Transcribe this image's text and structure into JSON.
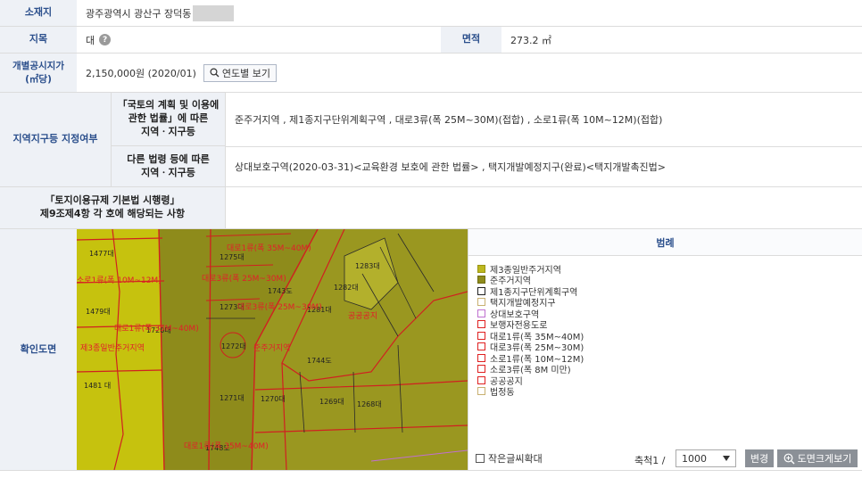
{
  "location": {
    "label": "소재지",
    "value": "광주광역시 광산구 장덕동"
  },
  "land_category": {
    "label": "지목",
    "value": "대",
    "help": "?",
    "area_label": "면적",
    "area_value": "273.2 ㎡"
  },
  "price": {
    "label": "개별공시지가\n(㎡당)",
    "value": "2,150,000원 (2020/01)",
    "button": "연도별 보기"
  },
  "zoning": {
    "label": "지역지구등 지정여부",
    "national_label": "「국토의 계획 및 이용에\n관한 법률」에 따른\n지역ㆍ지구등",
    "national_value": "준주거지역 , 제1종지구단위계획구역 , 대로3류(폭 25M~30M)(접합) , 소로1류(폭 10M~12M)(접합)",
    "other_label": "다른 법령 등에 따른\n지역ㆍ지구등",
    "other_value": "상대보호구역(2020-03-31)<교육환경 보호에 관한 법률> , 택지개발예정지구(완료)<택지개발촉진법>"
  },
  "enforcement": {
    "label": "「토지이용규제 기본법 시행령」\n제9조제4항 각 호에 해당되는 사항",
    "value": ""
  },
  "map_section": {
    "label": "확인도면",
    "parcels": [
      "1477대",
      "1275대",
      "1283대",
      "1282대",
      "1743도",
      "1273대",
      "1281대",
      "1479대",
      "1720대",
      "1272대",
      "1744도",
      "1481 대",
      "1271대",
      "1270대",
      "1269대",
      "1268대",
      "1748도"
    ],
    "red_labels": [
      "제3종일반주거지역",
      "준주거지역",
      "대로1류(폭 35M~40M)",
      "대로3류(폭 25M~30M)",
      "공공공지",
      "대로1류(폭 35M~40M)",
      "소로1류(폭 10M~12M)",
      "대로1류(폭 35M~40M)",
      "대로3류(폭 25M~30M)"
    ]
  },
  "legend": {
    "title": "범례",
    "items": [
      {
        "label": "제3종일반주거지역",
        "color": "#bdb820",
        "border": "#9a9410"
      },
      {
        "label": "준주거지역",
        "color": "#8f8c1c",
        "border": "#6f6c10"
      },
      {
        "label": "제1종지구단위계획구역",
        "color": "#ffffff",
        "border": "#222222"
      },
      {
        "label": "택지개발예정지구",
        "color": "#ffffff",
        "border": "#c8b070"
      },
      {
        "label": "상대보호구역",
        "color": "#ffffff",
        "border": "#c070d0"
      },
      {
        "label": "보행자전용도로",
        "color": "#ffffff",
        "border": "#e02020"
      },
      {
        "label": "대로1류(폭 35M~40M)",
        "color": "#ffffff",
        "border": "#e02020"
      },
      {
        "label": "대로3류(폭 25M~30M)",
        "color": "#ffffff",
        "border": "#e02020"
      },
      {
        "label": "소로1류(폭 10M~12M)",
        "color": "#ffffff",
        "border": "#e02020"
      },
      {
        "label": "소로3류(폭 8M 미만)",
        "color": "#ffffff",
        "border": "#e02020"
      },
      {
        "label": "공공공지",
        "color": "#ffffff",
        "border": "#e02020"
      },
      {
        "label": "법정동",
        "color": "#ffffff",
        "border": "#c8b070"
      }
    ],
    "small_text": "작은글씨확대",
    "scale_label": "축척1 /",
    "scale_value": "1000",
    "change_button": "변경",
    "enlarge_button": "도면크게보기"
  }
}
